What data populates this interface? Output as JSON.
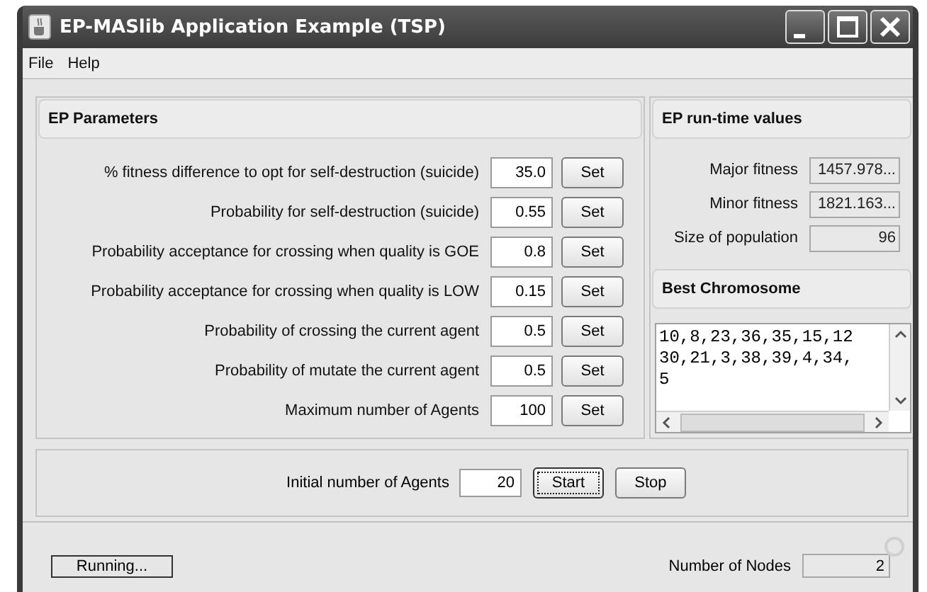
{
  "window": {
    "title": "EP-MASlib Application Example (TSP)"
  },
  "menu": [
    {
      "label": "File"
    },
    {
      "label": "Help"
    }
  ],
  "parameters": {
    "title": "EP Parameters",
    "rows": [
      {
        "label": "% fitness difference to opt for self-destruction (suicide)",
        "value": "35.0",
        "button": "Set"
      },
      {
        "label": "Probability for self-destruction (suicide)",
        "value": "0.55",
        "button": "Set"
      },
      {
        "label": "Probability acceptance for crossing when quality is GOE",
        "value": "0.8",
        "button": "Set"
      },
      {
        "label": "Probability acceptance for crossing when quality is LOW",
        "value": "0.15",
        "button": "Set"
      },
      {
        "label": "Probability of crossing the current agent",
        "value": "0.5",
        "button": "Set"
      },
      {
        "label": "Probability of mutate the current agent",
        "value": "0.5",
        "button": "Set"
      },
      {
        "label": "Maximum number of Agents",
        "value": "100",
        "button": "Set"
      }
    ]
  },
  "runtime": {
    "title": "EP run-time values",
    "rows": [
      {
        "label": "Major fitness",
        "value": "1457.978...",
        "editable": false
      },
      {
        "label": "Minor fitness",
        "value": "1821.163...",
        "editable": false
      },
      {
        "label": "Size of population",
        "value": "96",
        "editable": false
      }
    ]
  },
  "best_chromosome": {
    "title": "Best Chromosome",
    "lines": [
      "10,8,23,36,35,15,12",
      "30,21,3,38,39,4,34,",
      "5"
    ]
  },
  "controls": {
    "label": "Initial number of Agents",
    "value": "20",
    "buttons": [
      {
        "label": "Start",
        "focused": true
      },
      {
        "label": "Stop",
        "focused": false
      }
    ]
  },
  "status": {
    "text": "Running...",
    "nodes_label": "Number of Nodes",
    "nodes_value": "2"
  }
}
